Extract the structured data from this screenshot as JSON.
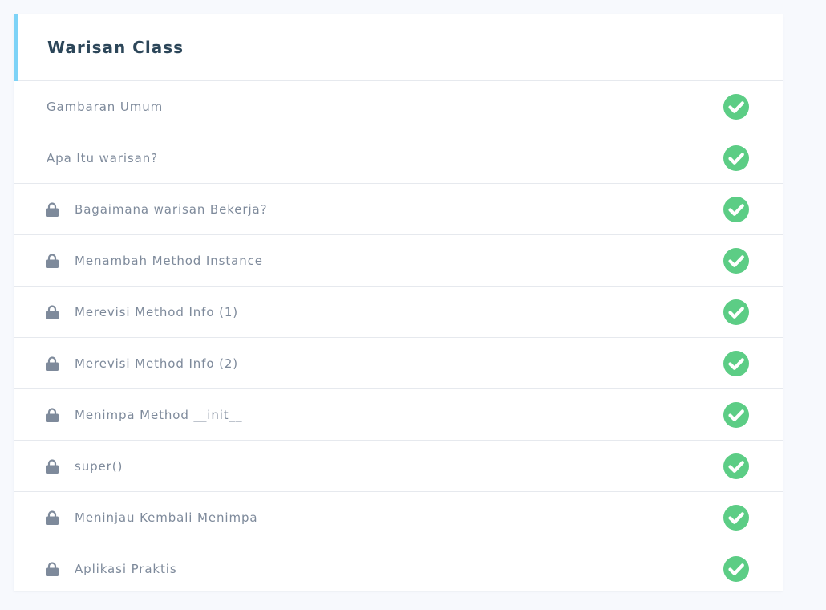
{
  "section": {
    "title": "Warisan Class",
    "accent_color": "#7dd3f7"
  },
  "status_color": "#5ccd85",
  "lessons": [
    {
      "label": "Gambaran Umum",
      "locked": false,
      "completed": true,
      "icon": "check-circle-icon"
    },
    {
      "label": "Apa Itu warisan?",
      "locked": false,
      "completed": true,
      "icon": "check-circle-icon"
    },
    {
      "label": "Bagaimana warisan Bekerja?",
      "locked": true,
      "completed": true,
      "icon": "check-circle-icon"
    },
    {
      "label": "Menambah Method Instance",
      "locked": true,
      "completed": true,
      "icon": "check-circle-icon"
    },
    {
      "label": "Merevisi Method Info (1)",
      "locked": true,
      "completed": true,
      "icon": "check-circle-icon"
    },
    {
      "label": "Merevisi Method Info (2)",
      "locked": true,
      "completed": true,
      "icon": "check-circle-icon"
    },
    {
      "label": "Menimpa Method __init__",
      "locked": true,
      "completed": true,
      "icon": "check-circle-icon"
    },
    {
      "label": "super()",
      "locked": true,
      "completed": true,
      "icon": "check-circle-icon"
    },
    {
      "label": "Meninjau Kembali Menimpa",
      "locked": true,
      "completed": true,
      "icon": "check-circle-icon"
    },
    {
      "label": "Aplikasi Praktis",
      "locked": true,
      "completed": true,
      "icon": "check-circle-icon"
    }
  ]
}
